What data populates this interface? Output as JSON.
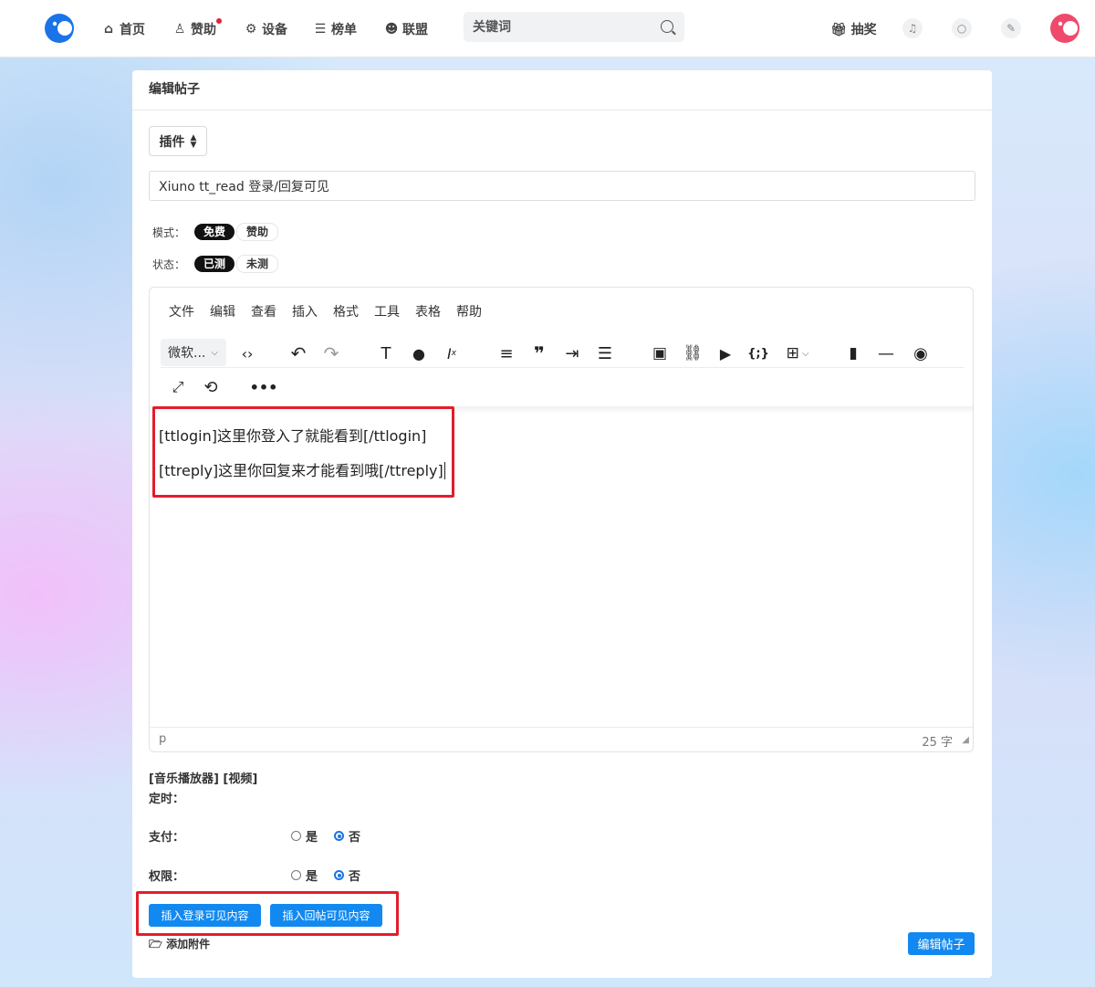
{
  "nav": {
    "items": [
      {
        "label": "首页",
        "icon": "home-icon"
      },
      {
        "label": "赞助",
        "icon": "sponsor-icon"
      },
      {
        "label": "设备",
        "icon": "device-icon"
      },
      {
        "label": "榜单",
        "icon": "ranking-icon"
      },
      {
        "label": "联盟",
        "icon": "users-icon"
      }
    ],
    "search_placeholder": "关键词",
    "lottery": "抽奖"
  },
  "page": {
    "title": "编辑帖子",
    "plugin_button": "插件",
    "post_title_value": "Xiuno tt_read 登录/回复可见",
    "mode_label": "模式：",
    "mode_options": [
      "免费",
      "赞助"
    ],
    "status_label": "状态：",
    "status_options": [
      "已测",
      "未测"
    ]
  },
  "editor": {
    "menu": [
      "文件",
      "编辑",
      "查看",
      "插入",
      "格式",
      "工具",
      "表格",
      "帮助"
    ],
    "font_select": "微软...",
    "content_lines": [
      "[ttlogin]这里你登入了就能看到[/ttlogin]",
      "[ttreply]这里你回复来才能看到哦[/ttreply]"
    ],
    "status_path": "p",
    "word_count": "25 字"
  },
  "extras": {
    "tags_line": "[音乐播放器] [视频]",
    "timer_label": "定时：",
    "pay_label": "支付：",
    "perm_label": "权限：",
    "yes": "是",
    "no": "否",
    "insert_login_btn": "插入登录可见内容",
    "insert_reply_btn": "插入回帖可见内容",
    "attach_label": "添加附件",
    "submit_btn": "编辑帖子"
  },
  "colors": {
    "accent": "#1289f0",
    "highlight_box": "#e21d2b",
    "logo": "#1a73e8",
    "avatar": "#ef4a6b"
  }
}
